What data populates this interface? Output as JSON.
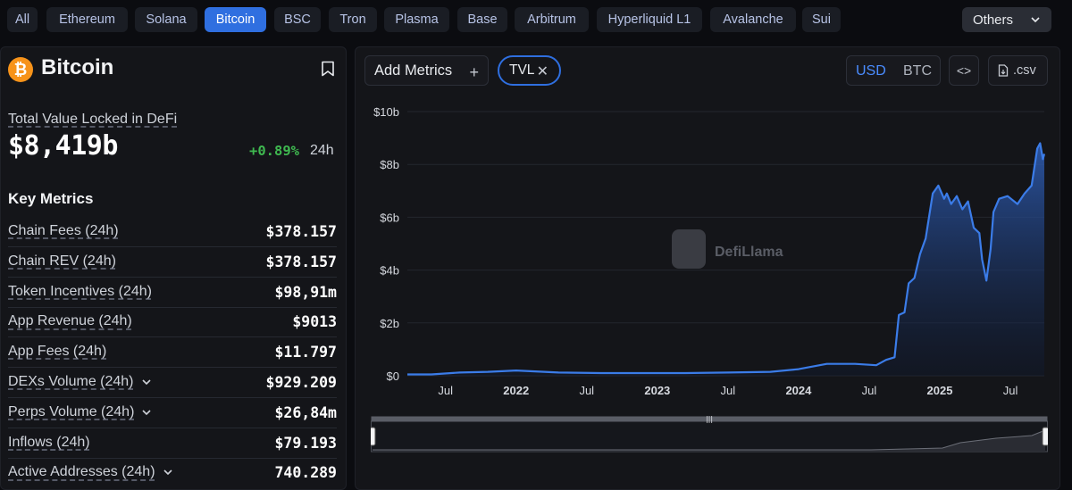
{
  "tabs": {
    "items": [
      "All",
      "Ethereum",
      "Solana",
      "Bitcoin",
      "BSC",
      "Tron",
      "Plasma",
      "Base",
      "Arbitrum",
      "Hyperliquid L1",
      "Avalanche",
      "Sui"
    ],
    "active": "Bitcoin",
    "others_label": "Others"
  },
  "summary": {
    "chain_name": "Bitcoin",
    "coin_symbol": "₿",
    "tvl_label": "Total Value Locked in DeFi",
    "tvl_value": "$8,419b",
    "tvl_change": "+0.89%",
    "tvl_period": "24h",
    "key_metrics_title": "Key Metrics"
  },
  "metrics": [
    {
      "label": "Chain Fees (24h)",
      "value": "$378.157",
      "expandable": false
    },
    {
      "label": "Chain REV (24h)",
      "value": "$378.157",
      "expandable": false
    },
    {
      "label": "Token Incentives (24h)",
      "value": "$98,91m",
      "expandable": false
    },
    {
      "label": "App Revenue (24h)",
      "value": "$9013",
      "expandable": false
    },
    {
      "label": "App Fees (24h)",
      "value": "$11.797",
      "expandable": false
    },
    {
      "label": "DEXs Volume (24h)",
      "value": "$929.209",
      "expandable": true
    },
    {
      "label": "Perps Volume (24h)",
      "value": "$26,84m",
      "expandable": true
    },
    {
      "label": "Inflows (24h)",
      "value": "$79.193",
      "expandable": false
    },
    {
      "label": "Active Addresses (24h)",
      "value": "740.289",
      "expandable": true
    }
  ],
  "toolbar": {
    "add_metrics_label": "Add Metrics",
    "add_icon": "plus-icon",
    "chip_label": "TVL",
    "chip_close_icon": "close-icon",
    "currency_usd": "USD",
    "currency_btc": "BTC",
    "currency_selected": "USD",
    "embed_label": "<>",
    "csv_label": ".csv"
  },
  "chart_data": {
    "type": "area",
    "watermark": "DefiLlama",
    "y_ticks": [
      "$0",
      "$2b",
      "$4b",
      "$6b",
      "$8b",
      "$10b"
    ],
    "x_ticks": [
      {
        "label": "Jul",
        "x": 2021.5,
        "bold": false
      },
      {
        "label": "2022",
        "x": 2022.0,
        "bold": true
      },
      {
        "label": "Jul",
        "x": 2022.5,
        "bold": false
      },
      {
        "label": "2023",
        "x": 2023.0,
        "bold": true
      },
      {
        "label": "Jul",
        "x": 2023.5,
        "bold": false
      },
      {
        "label": "2024",
        "x": 2024.0,
        "bold": true
      },
      {
        "label": "Jul",
        "x": 2024.5,
        "bold": false
      },
      {
        "label": "2025",
        "x": 2025.0,
        "bold": true
      },
      {
        "label": "Jul",
        "x": 2025.5,
        "bold": false
      }
    ],
    "ylim": [
      0,
      10
    ],
    "xlim": [
      2021.23,
      2025.74
    ],
    "y_unit": "billion USD",
    "series": [
      {
        "color": "#3b7ce8",
        "x": [
          2021.23,
          2021.4,
          2021.6,
          2021.8,
          2022.0,
          2022.3,
          2022.6,
          2022.9,
          2023.2,
          2023.5,
          2023.8,
          2024.0,
          2024.2,
          2024.4,
          2024.55,
          2024.62,
          2024.68,
          2024.71,
          2024.75,
          2024.78,
          2024.82,
          2024.86,
          2024.9,
          2024.95,
          2024.99,
          2025.03,
          2025.05,
          2025.08,
          2025.12,
          2025.16,
          2025.2,
          2025.24,
          2025.28,
          2025.3,
          2025.33,
          2025.36,
          2025.38,
          2025.42,
          2025.48,
          2025.55,
          2025.6,
          2025.65,
          2025.69,
          2025.71,
          2025.73,
          2025.74
        ],
        "y": [
          0.05,
          0.05,
          0.12,
          0.15,
          0.2,
          0.12,
          0.1,
          0.1,
          0.1,
          0.12,
          0.15,
          0.25,
          0.45,
          0.45,
          0.4,
          0.6,
          0.7,
          2.3,
          2.4,
          3.5,
          3.7,
          4.6,
          5.2,
          6.9,
          7.2,
          6.7,
          6.9,
          6.5,
          6.8,
          6.3,
          6.6,
          5.6,
          5.4,
          4.4,
          3.6,
          4.8,
          6.2,
          6.7,
          6.8,
          6.5,
          6.9,
          7.2,
          8.6,
          8.8,
          8.2,
          8.4
        ]
      }
    ]
  }
}
